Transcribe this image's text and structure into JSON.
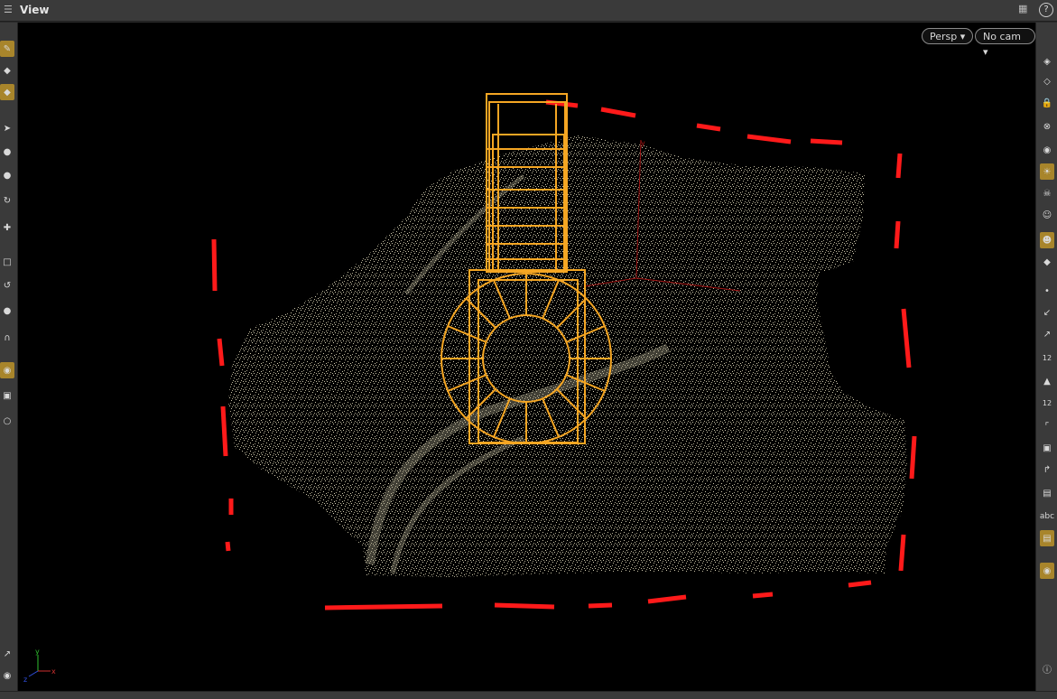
{
  "pane": {
    "title": "View"
  },
  "viewport": {
    "camera_view": "Persp",
    "camera": "No cam",
    "axis_labels": {
      "y": "y",
      "x": "x",
      "z": "z"
    }
  },
  "right_toolbar": {
    "text_tool_label": "abc",
    "numeric_label_a": "12",
    "numeric_label_b": "12"
  },
  "colors": {
    "selection": "#f5a623",
    "safe_frame": "#ff1a1a",
    "points": "#c8c3a8",
    "active_tool": "#a8852b"
  }
}
